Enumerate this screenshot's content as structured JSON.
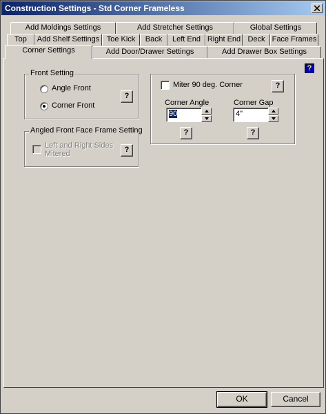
{
  "window": {
    "title": "Construction Settings - Std Corner Frameless"
  },
  "tabs": {
    "row1": [
      "Add Moldings Settings",
      "Add Stretcher Settings",
      "Global Settings"
    ],
    "row2": [
      "Top",
      "Add Shelf Settings",
      "Toe Kick",
      "Back",
      "Left End",
      "Right End",
      "Deck",
      "Face Frames"
    ],
    "row3": [
      "Corner Settings",
      "Add Door/Drawer Settings",
      "Add Drawer Box Settings"
    ],
    "active": "Corner Settings"
  },
  "front_setting": {
    "legend": "Front Setting",
    "angle_front": "Angle Front",
    "corner_front": "Corner Front",
    "selected": "Corner Front",
    "help": "?"
  },
  "angled_face_frame": {
    "legend": "Angled Front Face Frame Setting",
    "mitered_label_line1": "Left and Right Sides",
    "mitered_label_line2": "Mitered",
    "mitered_checked": false,
    "help": "?"
  },
  "miter_group": {
    "miter_label": "Miter 90 deg. Corner",
    "miter_checked": false,
    "help": "?",
    "corner_angle_label": "Corner Angle",
    "corner_angle_value": "90",
    "corner_angle_help": "?",
    "corner_gap_label": "Corner Gap",
    "corner_gap_value": "4\"",
    "corner_gap_help": "?"
  },
  "help_icon": "?",
  "buttons": {
    "ok": "OK",
    "cancel": "Cancel"
  }
}
